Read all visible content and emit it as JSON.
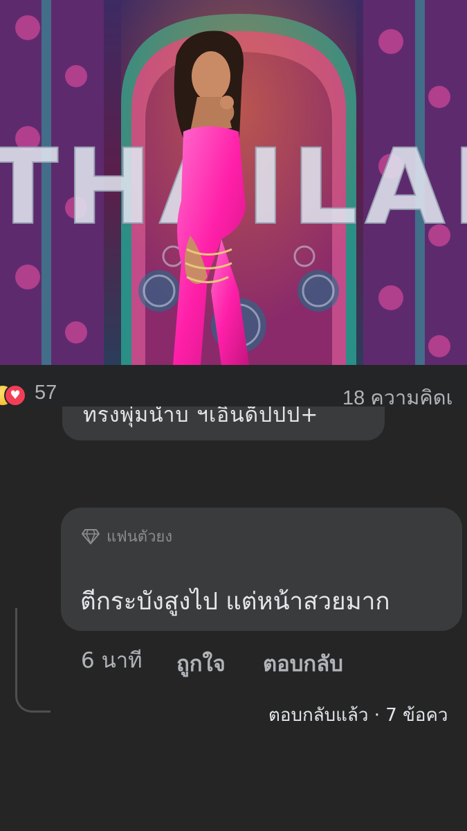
{
  "post": {
    "photo_sign_text": "THAILAND",
    "reaction_icons": [
      "haha-icon",
      "love-icon"
    ],
    "reaction_count": "57",
    "comment_count_label": "18 ความคิดเ"
  },
  "previous_comment": {
    "text_partial": "ทรงพุ่มน้ำบ ฯเอินด็ปปป+"
  },
  "comment": {
    "badge_icon": "diamond-icon",
    "badge_label": "แฟนตัวยง",
    "text": "ตีกระบังสูงไป แต่หน้าสวยมาก",
    "time": "6 นาที",
    "like_label": "ถูกใจ",
    "reply_label": "ตอบกลับ",
    "replies_link": "ตอบกลับแล้ว · 7 ข้อคว"
  },
  "colors": {
    "background": "#242526",
    "bubble": "#3a3b3c",
    "secondary_text": "#b0b3b8",
    "primary_text": "#e4e6eb",
    "love_red": "#f33e58",
    "haha_yellow": "#f7b125",
    "costume_pink": "#ff2fb0"
  }
}
